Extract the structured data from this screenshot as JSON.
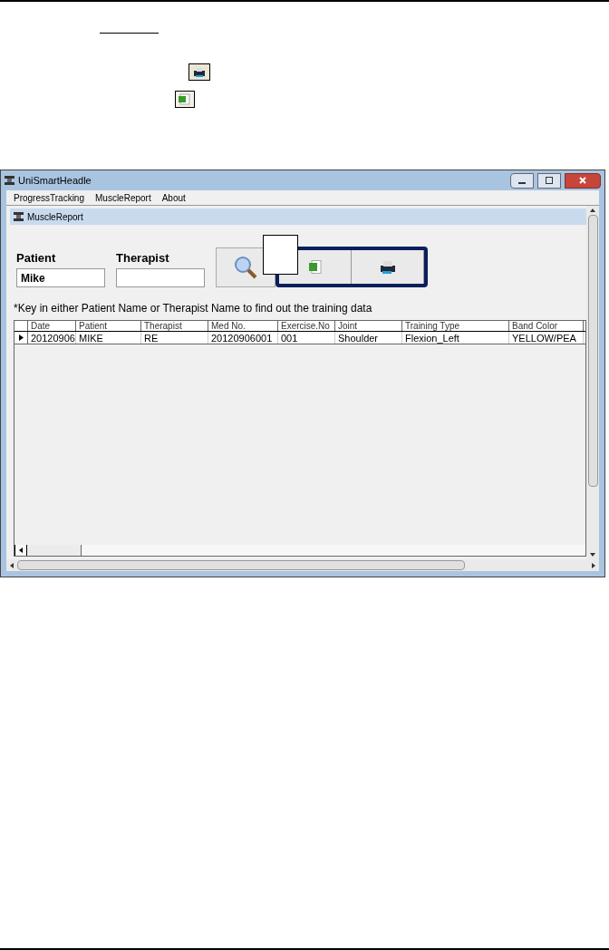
{
  "window": {
    "title": "UniSmartHeadle"
  },
  "menu": [
    "ProgressTracking",
    "MuscleReport",
    "About"
  ],
  "child_window": {
    "title": "MuscleReport"
  },
  "form": {
    "patient_label": "Patient",
    "patient_value": "Mike",
    "therapist_label": "Therapist",
    "note": "*Key in either Patient Name or Therapist  Name to find out the training data"
  },
  "table": {
    "columns": [
      "Date",
      "Patient",
      "Therapist",
      "Med No.",
      "Exercise.No",
      "Joint",
      "Training Type",
      "Band Color"
    ],
    "rows": [
      {
        "selected": true,
        "cells": [
          "20120906",
          "MIKE",
          "RE",
          "20120906001",
          "001",
          "Shoulder",
          "Flexion_Left",
          "YELLOW/PEA"
        ]
      }
    ]
  }
}
